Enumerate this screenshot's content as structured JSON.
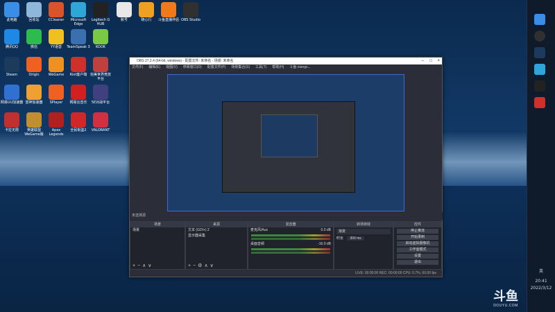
{
  "desktop": {
    "icons": [
      {
        "label": "此电脑",
        "color": "#3a8ee6"
      },
      {
        "label": "回收站",
        "color": "#8fb7d9"
      },
      {
        "label": "CCleaner",
        "color": "#d9532b"
      },
      {
        "label": "Microsoft Edge",
        "color": "#2fa6d8"
      },
      {
        "label": "Logitech G HUB",
        "color": "#222222"
      },
      {
        "label": "账号",
        "color": "#e8e8e8"
      },
      {
        "label": "随心行",
        "color": "#f0a020"
      },
      {
        "label": "斗鱼直播伴侣",
        "color": "#f07a1a"
      },
      {
        "label": "OBS Studio",
        "color": "#303030"
      },
      {
        "label": "腾讯QQ",
        "color": "#1e88e5"
      },
      {
        "label": "微信",
        "color": "#2dbb4e"
      },
      {
        "label": "YY语音",
        "color": "#f0c020"
      },
      {
        "label": "TeamSpeak 3",
        "color": "#3a6fb0"
      },
      {
        "label": "KOOK",
        "color": "#7ac943"
      },
      {
        "label": "Steam",
        "color": "#1b3a5c"
      },
      {
        "label": "Origin",
        "color": "#f06020"
      },
      {
        "label": "WeGame",
        "color": "#f09020"
      },
      {
        "label": "Riot客户端",
        "color": "#d0302a"
      },
      {
        "label": "完美世界竞技平台",
        "color": "#c04040"
      },
      {
        "label": "网易UU加速器",
        "color": "#3070d0"
      },
      {
        "label": "雷神加速器",
        "color": "#f0a030"
      },
      {
        "label": "SPlayer",
        "color": "#f06020"
      },
      {
        "label": "网易云音乐",
        "color": "#d02020"
      },
      {
        "label": "5E对战平台",
        "color": "#404080"
      },
      {
        "label": "卡拉无限",
        "color": "#c03030"
      },
      {
        "label": "英雄联盟WeGame版",
        "color": "#c09030"
      },
      {
        "label": "Apex Legends",
        "color": "#b02020"
      },
      {
        "label": "全民街篮2",
        "color": "#d02828"
      },
      {
        "label": "VALORANT",
        "color": "#d03040"
      }
    ]
  },
  "taskbar": {
    "lang": "英",
    "time": "20:41",
    "date": "2022/3/12"
  },
  "obs": {
    "title": "OBS 27.2.4 (64-bit, windows) - 配置文件: 未命名 - 场景: 未命名",
    "menu": [
      "文件(F)",
      "编辑(E)",
      "视图(V)",
      "停靠窗口(D)",
      "配置文件(P)",
      "场景集合(S)",
      "工具(T)",
      "帮助(H)",
      "斗鱼-xiangx..."
    ],
    "scene_bar": "未选择源",
    "panels": {
      "scenes": {
        "header": "场景",
        "items": [
          "场景"
        ]
      },
      "sources": {
        "header": "来源",
        "items": [
          "文本 (GDI+) 2",
          "显示器采集"
        ]
      },
      "mixer": {
        "header": "混音器",
        "channels": [
          {
            "name": "麦克风/Aux",
            "db": "0.0 dB"
          },
          {
            "name": "桌面音频",
            "db": "-16.0 dB"
          }
        ]
      },
      "transitions": {
        "header": "转场特效",
        "type": "渐变",
        "duration_label": "时长",
        "duration": "300 ms"
      },
      "controls": {
        "header": "控件",
        "buttons": [
          "停止推流",
          "开始录制",
          "启动虚拟摄像机",
          "工作室模式",
          "设置",
          "退出"
        ]
      }
    },
    "status": "LIVE: 00:00:00   REC: 00:00:00   CPU: 0.7%, 60.00 fps"
  },
  "watermark": {
    "logo": "斗鱼",
    "sub": "DOUYU.COM"
  }
}
